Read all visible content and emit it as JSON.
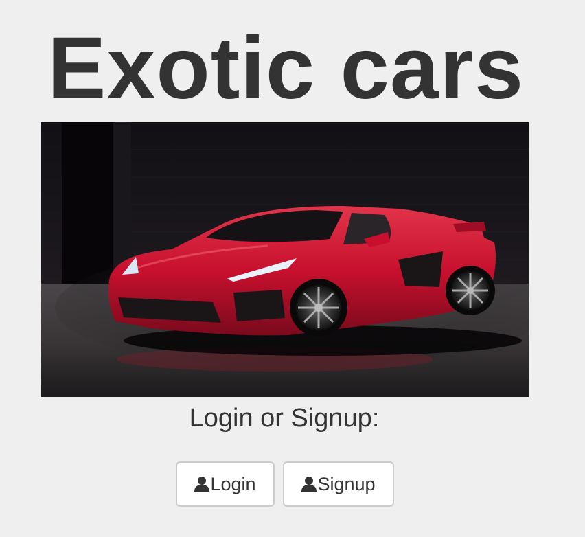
{
  "header": {
    "title": "Exotic cars"
  },
  "hero": {
    "image_alt": "red sports car in dark studio",
    "icon": "car-photo"
  },
  "auth": {
    "prompt": "Login or Signup:",
    "login_label": "Login",
    "signup_label": "Signup",
    "button_icon": "user-icon"
  },
  "colors": {
    "background": "#efefef",
    "text": "#333333",
    "button_bg": "#ffffff",
    "button_border": "#cccccc",
    "car_red": "#c8102e"
  }
}
